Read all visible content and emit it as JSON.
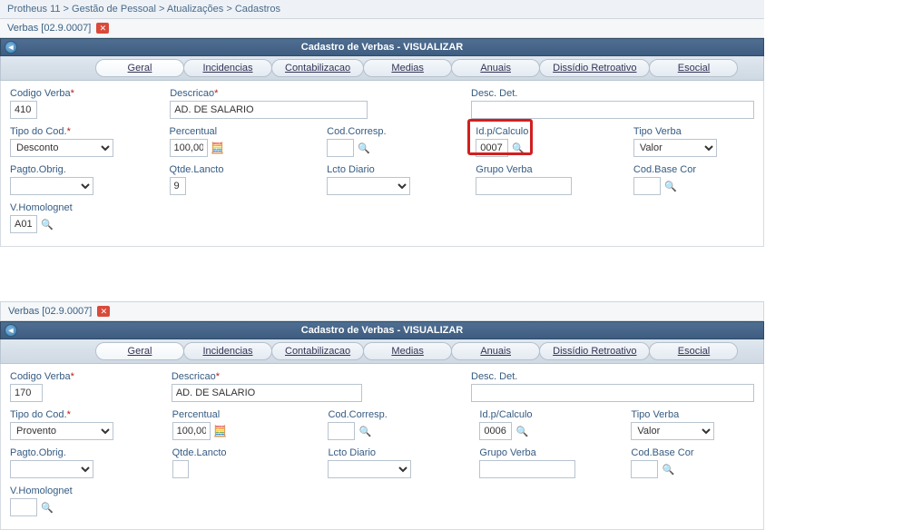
{
  "breadcrumb": "Protheus 11 > Gestão de Pessoal > Atualizações > Cadastros",
  "tab_label": "Verbas [02.9.0007]",
  "title": "Cadastro de Verbas - VISUALIZAR",
  "subtabs": {
    "geral": "Geral",
    "incidencias": "Incidencias",
    "contabilizacao": "Contabilizacao",
    "medias": "Medias",
    "anuais": "Anuais",
    "dissidio": "Dissídio Retroativo",
    "esocial": "Esocial"
  },
  "labels": {
    "codigo_verba": "Codigo Verba",
    "descricao": "Descricao",
    "desc_det": "Desc. Det.",
    "tipo_cod": "Tipo do Cod.",
    "percentual": "Percentual",
    "cod_corresp": "Cod.Corresp.",
    "idp_calculo": "Id.p/Calculo",
    "tipo_verba": "Tipo Verba",
    "pagto_obrig": "Pagto.Obrig.",
    "qtde_lancto": "Qtde.Lancto",
    "lcto_diario": "Lcto Diario",
    "grupo_verba": "Grupo Verba",
    "cod_base_cor": "Cod.Base Cor",
    "vhomolognet": "V.Homolognet"
  },
  "top": {
    "codigo_verba": "410",
    "descricao": "AD. DE SALARIO",
    "desc_det": "",
    "tipo_cod": "Desconto",
    "percentual": "100,000",
    "cod_corresp": "",
    "idp_calculo": "0007",
    "tipo_verba": "Valor",
    "pagto_obrig": "",
    "qtde_lancto": "9",
    "lcto_diario": "",
    "grupo_verba": "",
    "cod_base_cor": "",
    "vhomolognet": "A01"
  },
  "bottom": {
    "codigo_verba": "170",
    "descricao": "AD. DE SALARIO",
    "desc_det": "",
    "tipo_cod": "Provento",
    "percentual": "100,000",
    "cod_corresp": "",
    "idp_calculo": "0006",
    "tipo_verba": "Valor",
    "pagto_obrig": "",
    "qtde_lancto": "",
    "lcto_diario": "",
    "grupo_verba": "",
    "cod_base_cor": "",
    "vhomolognet": ""
  }
}
